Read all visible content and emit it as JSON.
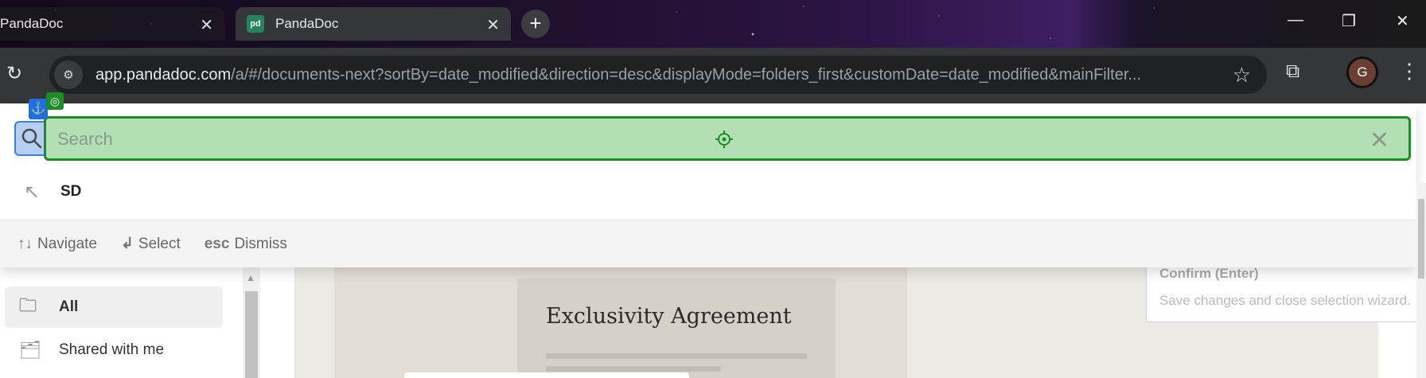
{
  "browser": {
    "tabs": [
      {
        "title": "PandaDoc",
        "active": false
      },
      {
        "title": "PandaDoc",
        "active": true
      }
    ],
    "url_host": "app.pandadoc.com",
    "url_path": "/a/#/documents-next?sortBy=date_modified&direction=desc&displayMode=folders_first&customDate=date_modified&mainFilter...",
    "profile_initial": "G"
  },
  "palette": {
    "search_placeholder": "Search",
    "results": [
      {
        "label": "SD"
      }
    ],
    "hints": [
      {
        "key": "↑↓",
        "label": "Navigate"
      },
      {
        "key": "↲",
        "label": "Select"
      },
      {
        "key": "esc",
        "label": "Dismiss"
      }
    ]
  },
  "sidebar": {
    "items": [
      {
        "label": "All",
        "selected": true
      },
      {
        "label": "Shared with me",
        "selected": false
      }
    ]
  },
  "preview": {
    "document_title": "Exclusivity Agreement"
  },
  "tooltip": {
    "title": "Confirm (Enter)",
    "description": "Save changes and close selection wizard."
  },
  "colors": {
    "highlight_green": "#b3dfb5",
    "highlight_border": "#1d8b26",
    "anchor_blue": "#1f6fdd"
  }
}
